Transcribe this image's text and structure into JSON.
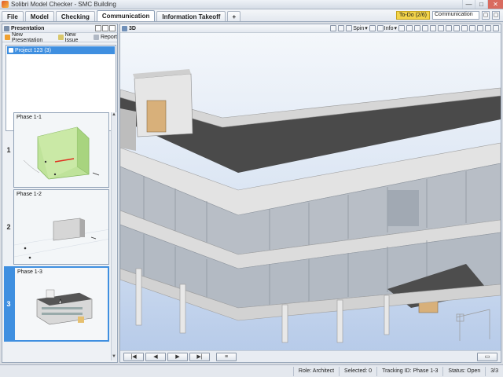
{
  "window": {
    "title": "Solibri Model Checker - SMC Building",
    "minimize": "—",
    "maximize": "□",
    "close": "✕"
  },
  "menu": {
    "tabs": [
      {
        "label": "File"
      },
      {
        "label": "Model"
      },
      {
        "label": "Checking"
      },
      {
        "label": "Communication"
      },
      {
        "label": "Information Takeoff"
      },
      {
        "label": "+"
      }
    ],
    "active_tab": "Communication",
    "todo": "To-Do (2/6)",
    "search_value": "Communication",
    "btn1": "▢",
    "btn2": "▢"
  },
  "presentation": {
    "title": "Presentation",
    "toolbar": {
      "new_presentation": "New Presentation",
      "new_issue": "New Issue",
      "report": "Report"
    },
    "project_item": "Project 123 (3)",
    "slides": [
      {
        "number": "1",
        "label": "Phase 1-1"
      },
      {
        "number": "2",
        "label": "Phase 1-2"
      },
      {
        "number": "3",
        "label": "Phase 1-3"
      }
    ],
    "colors": {
      "selection": "#3f8fe0"
    }
  },
  "view3d": {
    "title": "3D",
    "tools": {
      "spin": "Spin",
      "info": "Info"
    }
  },
  "playbar": {
    "first": "|◀",
    "prev": "◀",
    "next": "▶",
    "last": "▶|",
    "list": "≡",
    "present": "▭"
  },
  "status": {
    "role": "Role: Architect",
    "selected": "Selected: 0",
    "tracking": "Tracking ID: Phase 1-3",
    "status": "Status: Open",
    "page": "3/3"
  }
}
